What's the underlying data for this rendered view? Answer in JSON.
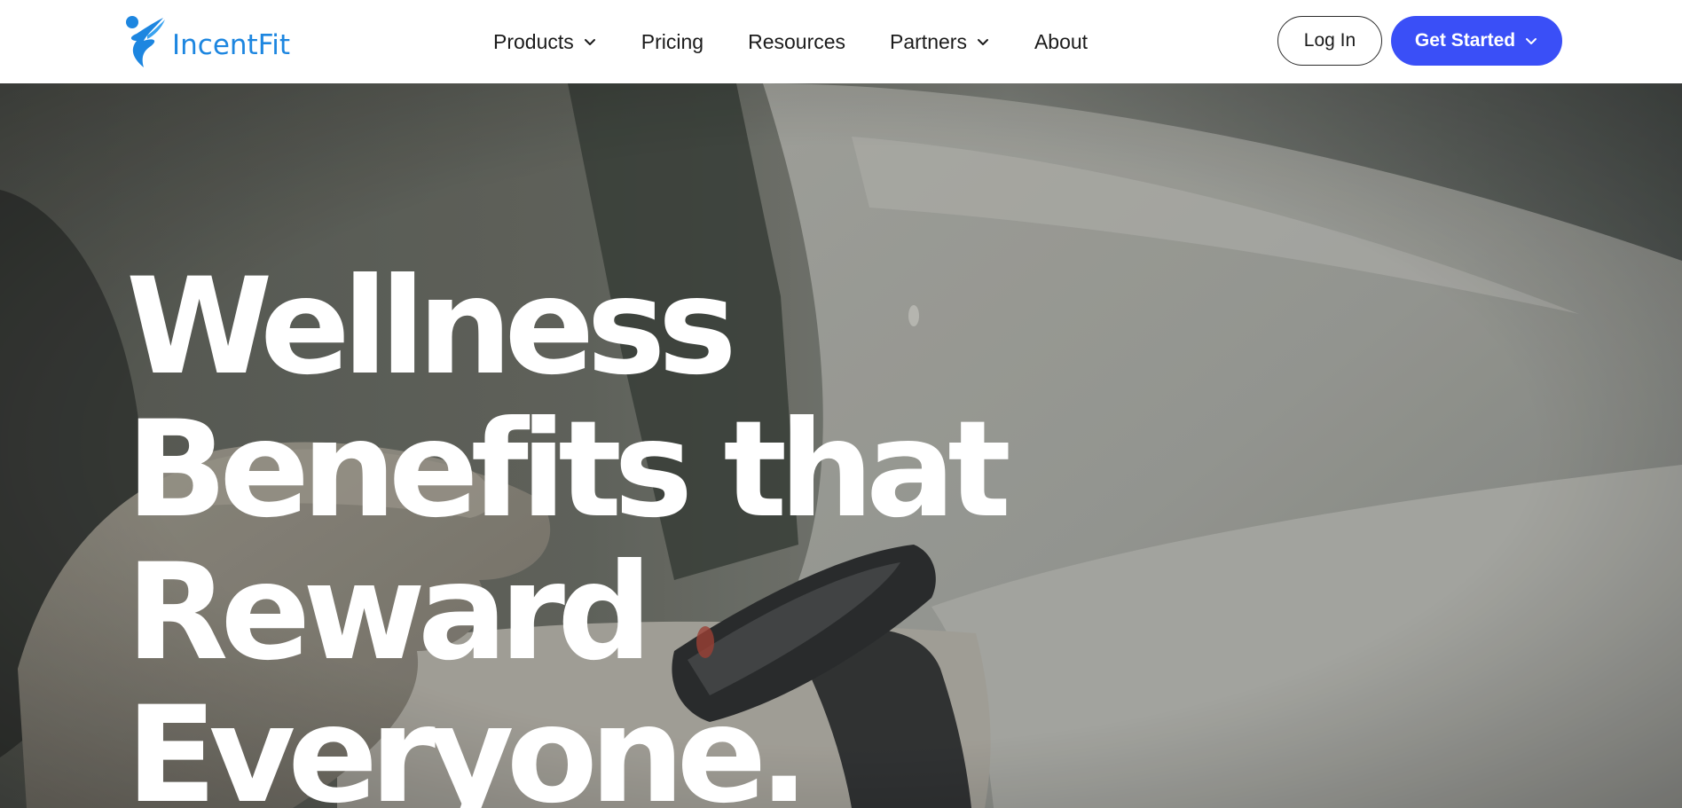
{
  "brand": {
    "name": "IncentFit",
    "color": "#1d86e0"
  },
  "nav": {
    "items": [
      {
        "label": "Products",
        "has_dropdown": true
      },
      {
        "label": "Pricing",
        "has_dropdown": false
      },
      {
        "label": "Resources",
        "has_dropdown": false
      },
      {
        "label": "Partners",
        "has_dropdown": true
      },
      {
        "label": "About",
        "has_dropdown": false
      }
    ]
  },
  "actions": {
    "login_label": "Log In",
    "get_started_label": "Get Started",
    "accent_color": "#3a4ff7"
  },
  "hero": {
    "title_lines": [
      "Wellness",
      "Benefits that",
      "Reward",
      "Everyone."
    ],
    "background": "photo of a hand touching a smartwatch"
  },
  "icons": {
    "dropdown": "chevron-down-icon",
    "logo_mark": "person-figure-icon"
  }
}
